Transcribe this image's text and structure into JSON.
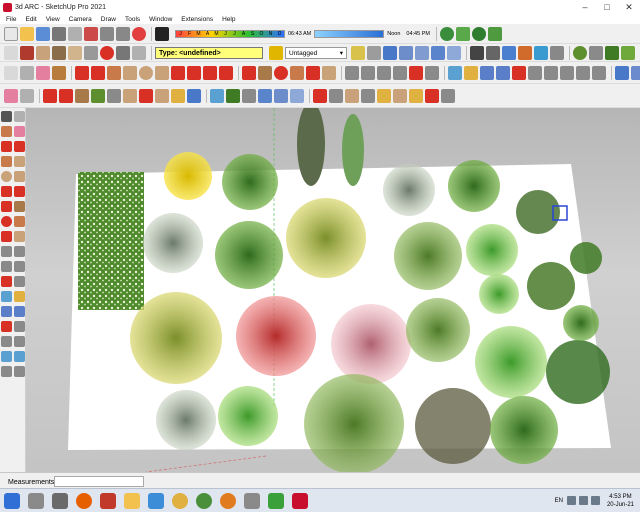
{
  "window": {
    "title": "3d ARC - SketchUp Pro 2021",
    "minimize": "–",
    "maximize": "□",
    "close": "✕"
  },
  "menu": [
    "File",
    "Edit",
    "View",
    "Camera",
    "Draw",
    "Tools",
    "Window",
    "Extensions",
    "Help"
  ],
  "shadows": {
    "months": [
      "J",
      "F",
      "M",
      "A",
      "M",
      "J",
      "J",
      "A",
      "S",
      "O",
      "N",
      "D"
    ],
    "time_start": "06:43 AM",
    "noon": "Noon",
    "time_end": "04:45 PM"
  },
  "entity_type": "Type: <undefined>",
  "tag": "Untagged",
  "status": {
    "measurements_label": "Measurements",
    "measurements_value": ""
  },
  "taskbar": {
    "lang": "EN",
    "time": "4:53 PM",
    "date": "20-Jun-21"
  },
  "colors": {
    "accent_red": "#d93025",
    "accent_yellow": "#ffff7a",
    "tree_greens": [
      "#5e8f2e",
      "#6fa83b",
      "#3f7a24",
      "#8cae3f",
      "#4d8a35",
      "#7aa65a"
    ],
    "blossom_yellow": "#f2d92b",
    "blossom_pink": "#e7909a",
    "blossom_red": "#e23b3b"
  },
  "icons": {
    "toolbar_row1": [
      "select-icon",
      "eraser-icon",
      "paint-icon",
      "orbit-icon",
      "pan-icon",
      "zoom-icon",
      "zoom-extents-icon",
      "undo-icon"
    ],
    "taskbar": [
      "start-icon",
      "search-icon",
      "task-view-icon",
      "firefox-icon",
      "media-icon",
      "file-explorer-icon",
      "chrome-icon",
      "vlc-icon",
      "camtasia-icon",
      "sketchup-icon",
      "settings-icon"
    ]
  }
}
